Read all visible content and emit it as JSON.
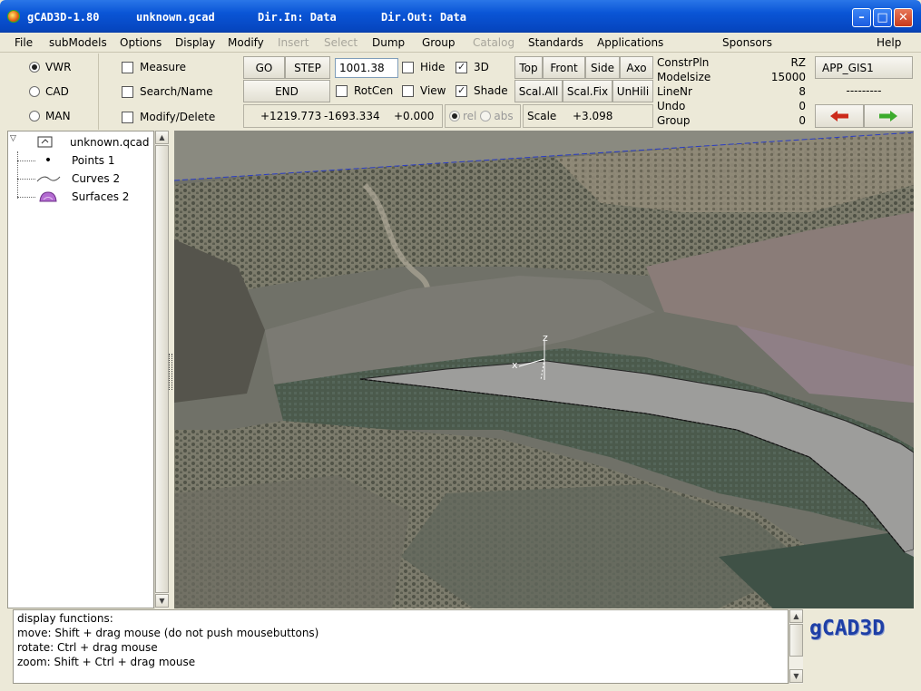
{
  "window": {
    "app_title": "gCAD3D-1.80",
    "file_name": "unknown.gcad",
    "dir_in": "Dir.In: Data",
    "dir_out": "Dir.Out: Data",
    "buttons": {
      "minimize_glyph": "–",
      "maximize_glyph": "□",
      "close_glyph": "✕"
    }
  },
  "menu": {
    "items": [
      {
        "label": "File",
        "enabled": true
      },
      {
        "label": "subModels",
        "enabled": true
      },
      {
        "label": "Options",
        "enabled": true
      },
      {
        "label": "Display",
        "enabled": true
      },
      {
        "label": "Modify",
        "enabled": true
      },
      {
        "label": "Insert",
        "enabled": false
      },
      {
        "label": "Select",
        "enabled": false
      },
      {
        "label": "Dump",
        "enabled": true
      },
      {
        "label": "Group",
        "enabled": true
      },
      {
        "label": "Catalog",
        "enabled": false
      },
      {
        "label": "Standards",
        "enabled": true
      },
      {
        "label": "Applications",
        "enabled": true
      },
      {
        "label": "Sponsors",
        "enabled": true
      },
      {
        "label": "Help",
        "enabled": true
      }
    ]
  },
  "toolbar": {
    "modes": [
      {
        "label": "VWR",
        "selected": true
      },
      {
        "label": "CAD",
        "selected": false
      },
      {
        "label": "MAN",
        "selected": false
      }
    ],
    "functions": [
      {
        "label": "Measure",
        "checked": false
      },
      {
        "label": "Search/Name",
        "checked": false
      },
      {
        "label": "Modify/Delete",
        "checked": false
      }
    ],
    "go_label": "GO",
    "step_label": "STEP",
    "end_label": "END",
    "value_field": "1001.38",
    "hide_label": "Hide",
    "hide_checked": false,
    "threed_label": "3D",
    "threed_checked": true,
    "rotcen_label": "RotCen",
    "rotcen_checked": false,
    "view_label": "View",
    "view_checked": false,
    "shade_label": "Shade",
    "shade_checked": true,
    "coord_x": "+1219.773",
    "coord_y": "-1693.334",
    "coord_z": "+0.000",
    "rel_label": "rel",
    "rel_selected": true,
    "abs_label": "abs",
    "abs_selected": false,
    "view_buttons": [
      "Top",
      "Front",
      "Side",
      "Axo"
    ],
    "scale_buttons": [
      "Scal.All",
      "Scal.Fix",
      "UnHili"
    ],
    "scale_label": "Scale",
    "scale_value": "+3.098",
    "info": [
      {
        "key": "ConstrPln",
        "value": "RZ"
      },
      {
        "key": "Modelsize",
        "value": "15000"
      },
      {
        "key": "LineNr",
        "value": "8"
      },
      {
        "key": "Undo",
        "value": "0"
      },
      {
        "key": "Group",
        "value": "0"
      }
    ],
    "app_name": "APP_GIS1",
    "app_status": "---------",
    "back_arrow_color": "#cc2a1a",
    "forward_arrow_color": "#3cab2c"
  },
  "tree": {
    "root": "unknown.qcad",
    "children": [
      {
        "label": "Points 1",
        "icon": "point-icon"
      },
      {
        "label": "Curves 2",
        "icon": "curve-icon"
      },
      {
        "label": "Surfaces 2",
        "icon": "surface-icon"
      }
    ]
  },
  "viewport": {
    "axis_z": "z",
    "axis_x": "x",
    "construction_line_color": "#2a3cc4"
  },
  "messages": [
    "display functions:",
    "move:   Shift + drag mouse (do not push mousebuttons)",
    "rotate: Ctrl + drag mouse",
    "zoom:   Shift + Ctrl + drag mouse"
  ],
  "logo": "gCAD3D"
}
